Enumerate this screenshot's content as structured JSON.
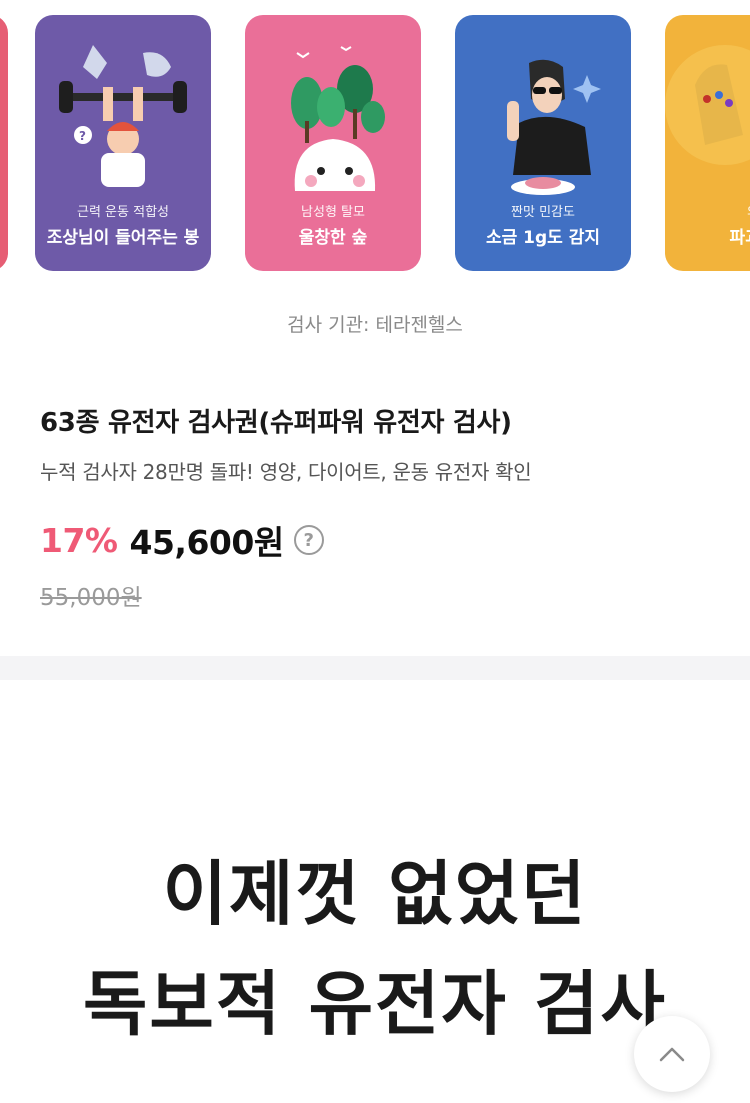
{
  "cards": [
    {
      "sub": "근력 운동 적합성",
      "main": "조상님이 들어주는 봉",
      "color": "#6e5aa8"
    },
    {
      "sub": "남성형 탈모",
      "main": "울창한 숲",
      "color": "#ea6f98"
    },
    {
      "sub": "짠맛 민감도",
      "main": "소금 1g도 감지",
      "color": "#4170c3"
    },
    {
      "sub": "의",
      "main": "파괴의",
      "color": "#f2b33b"
    }
  ],
  "provider": "검사 기관: 테라젠헬스",
  "product": {
    "title": "63종 유전자 검사권(슈퍼파워 유전자 검사)",
    "description": "누적 검사자 28만명 돌파! 영양, 다이어트, 운동 유전자 확인",
    "discount": "17%",
    "price": "45,600원",
    "original_price": "55,000원",
    "help_symbol": "?"
  },
  "headline": {
    "line1": "이제껏 없었던",
    "line2": "독보적 유전자 검사"
  },
  "icons": {
    "help": "question-circle-icon",
    "scroll_top": "chevron-up-icon"
  }
}
